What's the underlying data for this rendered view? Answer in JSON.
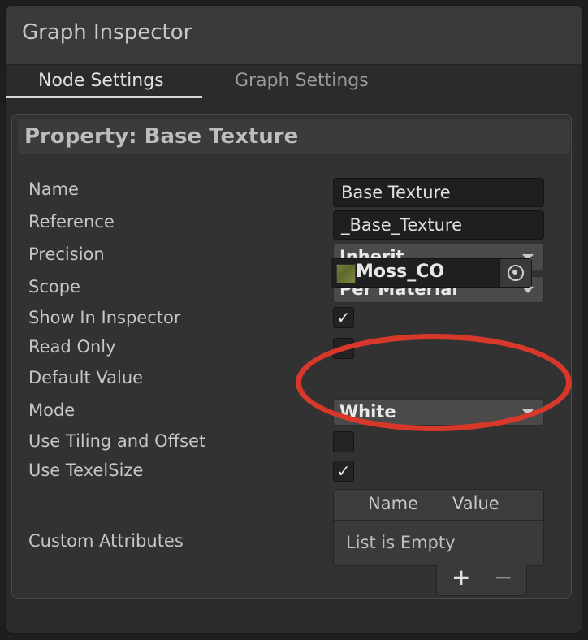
{
  "window": {
    "title": "Graph Inspector"
  },
  "tabs": [
    {
      "label": "Node Settings"
    },
    {
      "label": "Graph Settings"
    }
  ],
  "panel": {
    "header": "Property: Base Texture",
    "rows": {
      "name": {
        "label": "Name",
        "value": "Base Texture"
      },
      "reference": {
        "label": "Reference",
        "value": "_Base_Texture"
      },
      "precision": {
        "label": "Precision",
        "value": "Inherit"
      },
      "scope": {
        "label": "Scope",
        "value": "Per Material"
      },
      "show_in_inspector": {
        "label": "Show In Inspector",
        "checked": true,
        "mark": "✓"
      },
      "read_only": {
        "label": "Read Only",
        "checked": false
      },
      "default_value": {
        "label": "Default Value",
        "value": "Moss_CO",
        "icon": "target-picker-icon"
      },
      "mode": {
        "label": "Mode",
        "value": "White"
      },
      "use_tiling": {
        "label": "Use Tiling and Offset",
        "checked": false
      },
      "use_texel": {
        "label": "Use TexelSize",
        "checked": true,
        "mark": "✓"
      },
      "custom_attributes": {
        "label": "Custom Attributes",
        "columns": [
          "Name",
          "Value"
        ],
        "empty_text": "List is Empty",
        "add": "+",
        "remove": "−"
      }
    }
  },
  "annotation": {
    "color": "#d8382a",
    "shape": "ellipse"
  }
}
